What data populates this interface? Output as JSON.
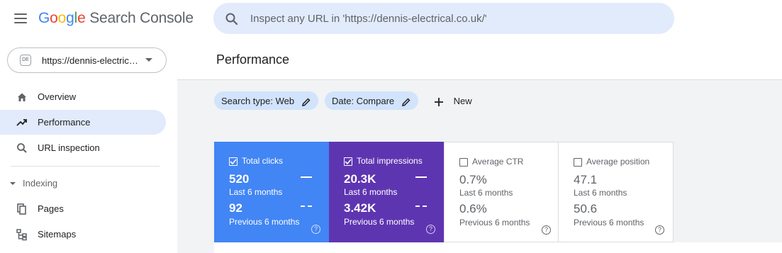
{
  "header": {
    "logo": {
      "google": [
        "G",
        "o",
        "o",
        "g",
        "l",
        "e"
      ],
      "product": "Search Console"
    },
    "search_placeholder": "Inspect any URL in 'https://dennis-electrical.co.uk/'"
  },
  "sidebar": {
    "property_url": "https://dennis-electrical.co.uk/",
    "items": [
      {
        "label": "Overview",
        "icon": "home-icon"
      },
      {
        "label": "Performance",
        "icon": "trending-up-icon",
        "active": true
      },
      {
        "label": "URL inspection",
        "icon": "search-icon"
      }
    ],
    "section": {
      "label": "Indexing"
    },
    "section_items": [
      {
        "label": "Pages",
        "icon": "pages-icon"
      },
      {
        "label": "Sitemaps",
        "icon": "sitemap-icon"
      }
    ]
  },
  "main": {
    "title": "Performance",
    "filters": [
      {
        "label": "Search type: Web"
      },
      {
        "label": "Date: Compare"
      }
    ],
    "new_label": "New"
  },
  "metrics": [
    {
      "title": "Total clicks",
      "checked": true,
      "value_current": "520",
      "period_current": "Last 6 months",
      "value_previous": "92",
      "period_previous": "Previous 6 months",
      "color": "#4285f4"
    },
    {
      "title": "Total impressions",
      "checked": true,
      "value_current": "20.3K",
      "period_current": "Last 6 months",
      "value_previous": "3.42K",
      "period_previous": "Previous 6 months",
      "color": "#5e35b1"
    },
    {
      "title": "Average CTR",
      "checked": false,
      "value_current": "0.7%",
      "period_current": "Last 6 months",
      "value_previous": "0.6%",
      "period_previous": "Previous 6 months",
      "color": "#ffffff"
    },
    {
      "title": "Average position",
      "checked": false,
      "value_current": "47.1",
      "period_current": "Last 6 months",
      "value_previous": "50.6",
      "period_previous": "Previous 6 months",
      "color": "#ffffff"
    }
  ],
  "help_glyph": "?"
}
